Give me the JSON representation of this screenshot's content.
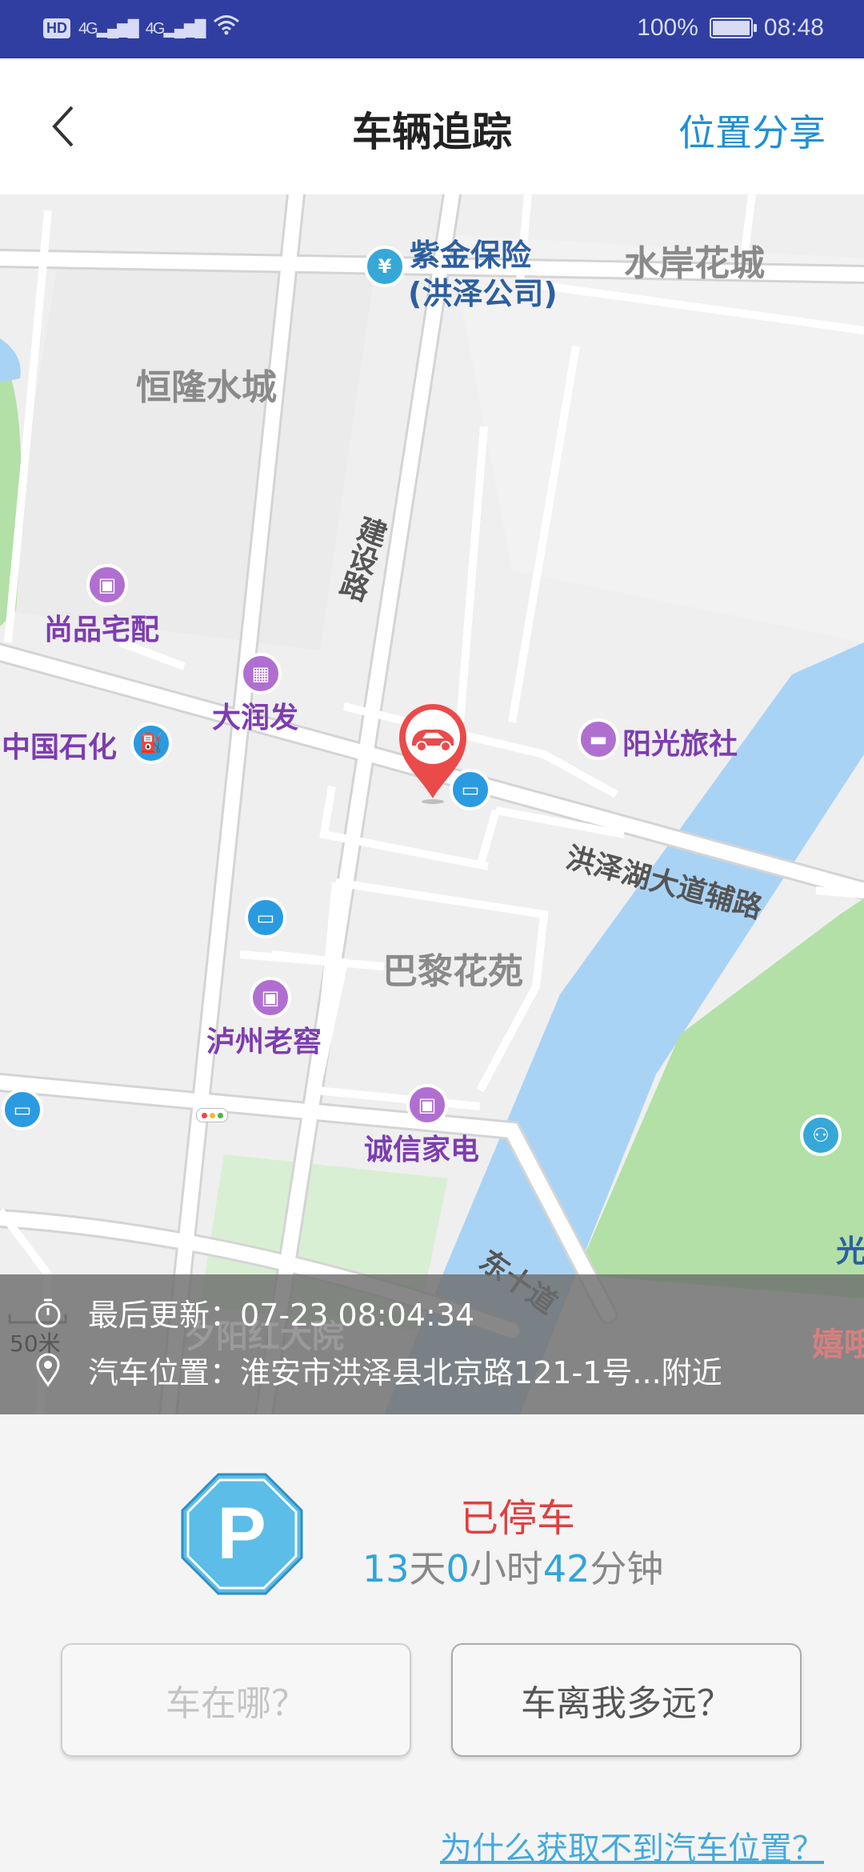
{
  "status_bar": {
    "network_label": "HD",
    "signal1": "4G",
    "signal2": "4G",
    "battery_pct": "100%",
    "time": "08:48"
  },
  "header": {
    "title": "车辆追踪",
    "share_label": "位置分享",
    "back_icon": "chevron-left-icon"
  },
  "map": {
    "labels": {
      "zijin": "紫金保险",
      "zijin_sub": "(洪泽公司)",
      "shuian": "水岸花城",
      "henglong": "恒隆水城",
      "jianshe": "建设路",
      "shangpin": "尚品宅配",
      "darunfa": "大润发",
      "sinopec": "中国石化",
      "yangguang": "阳光旅社",
      "hongzehu": "洪泽湖大道辅路",
      "bali": "巴黎花苑",
      "luzhou": "泸州老窖",
      "chengxin": "诚信家电",
      "dongshi": "东十道",
      "guang": "光",
      "yangdayuan": "夕阳红大院",
      "xixiao": "嬉哦",
      "scale": "50米"
    },
    "car_marker_icon": "car-location-pin-icon"
  },
  "info": {
    "last_update_label": "最后更新：",
    "last_update_value": "07-23 08:04:34",
    "location_label": "汽车位置：",
    "location_value": "淮安市洪泽县北京路121-1号...附近"
  },
  "parking": {
    "status": "已停车",
    "days": "13",
    "days_unit": "天",
    "hours": "0",
    "hours_unit": "小时",
    "minutes": "42",
    "minutes_unit": "分钟"
  },
  "buttons": {
    "where": "车在哪？",
    "how_far": "车离我多远？"
  },
  "help_link": "为什么获取不到汽车位置？",
  "colors": {
    "status_bar": "#2f3ea0",
    "accent_blue": "#1e8fd8",
    "parked_red": "#e04040",
    "duration_blue": "#2ea6d9",
    "river": "#a9d3f5",
    "park_green": "#b2e0a6"
  }
}
